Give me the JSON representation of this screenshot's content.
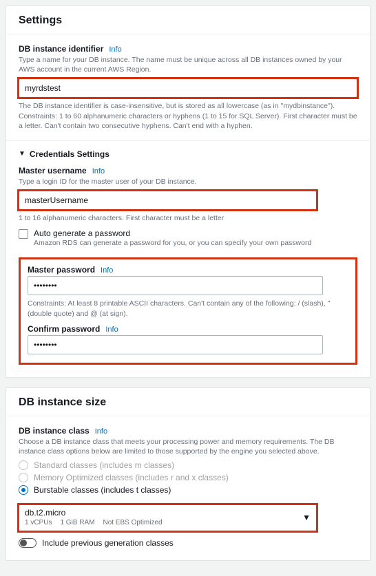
{
  "settings": {
    "title": "Settings",
    "db_identifier": {
      "label": "DB instance identifier",
      "info": "Info",
      "desc": "Type a name for your DB instance. The name must be unique across all DB instances owned by your AWS account in the current AWS Region.",
      "value": "myrdstest",
      "constraint": "The DB instance identifier is case-insensitive, but is stored as all lowercase (as in \"mydbinstance\"). Constraints: 1 to 60 alphanumeric characters or hyphens (1 to 15 for SQL Server). First character must be a letter. Can't contain two consecutive hyphens. Can't end with a hyphen."
    },
    "credentials": {
      "section_label": "Credentials Settings",
      "master_username": {
        "label": "Master username",
        "info": "Info",
        "desc": "Type a login ID for the master user of your DB instance.",
        "value": "masterUsername",
        "constraint": "1 to 16 alphanumeric characters. First character must be a letter"
      },
      "auto_generate": {
        "label": "Auto generate a password",
        "desc": "Amazon RDS can generate a password for you, or you can specify your own password"
      },
      "master_password": {
        "label": "Master password",
        "info": "Info",
        "value": "••••••••",
        "constraint": "Constraints: At least 8 printable ASCII characters. Can't contain any of the following: / (slash), \"(double quote) and @ (at sign)."
      },
      "confirm_password": {
        "label": "Confirm password",
        "info": "Info",
        "value": "••••••••"
      }
    }
  },
  "instance_size": {
    "title": "DB instance size",
    "db_class": {
      "label": "DB instance class",
      "info": "Info",
      "desc": "Choose a DB instance class that meets your processing power and memory requirements. The DB instance class options below are limited to those supported by the engine you selected above."
    },
    "radios": [
      {
        "label": "Standard classes (includes m classes)",
        "state": "disabled"
      },
      {
        "label": "Memory Optimized classes (includes r and x classes)",
        "state": "disabled"
      },
      {
        "label": "Burstable classes (includes t classes)",
        "state": "selected"
      }
    ],
    "select": {
      "value": "db.t2.micro",
      "sub1": "1 vCPUs",
      "sub2": "1 GiB RAM",
      "sub3": "Not EBS Optimized"
    },
    "include_prev": "Include previous generation classes"
  }
}
